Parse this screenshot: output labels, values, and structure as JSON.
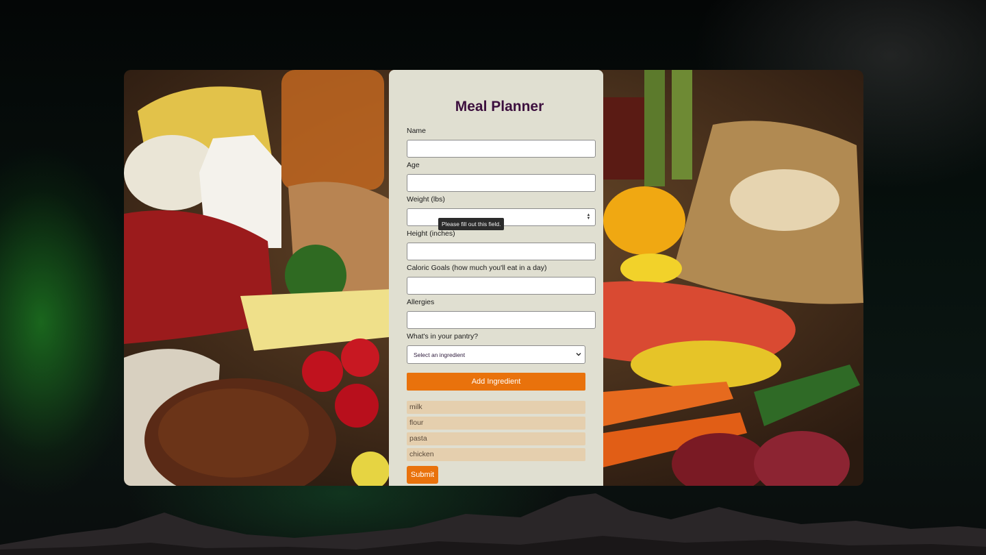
{
  "app": {
    "title": "Meal Planner"
  },
  "form": {
    "name": {
      "label": "Name",
      "value": ""
    },
    "age": {
      "label": "Age",
      "value": ""
    },
    "weight": {
      "label": "Weight (lbs)",
      "value": "",
      "validation_message": "Please fill out this field."
    },
    "height": {
      "label": "Height (inches)",
      "value": ""
    },
    "calories": {
      "label": "Caloric Goals (how much you'll eat in a day)",
      "value": ""
    },
    "allergies": {
      "label": "Allergies",
      "value": ""
    },
    "pantry": {
      "label": "What's in your pantry?",
      "select_placeholder": "Select an ingredient",
      "add_label": "Add Ingredient",
      "items": [
        "milk",
        "flour",
        "pasta",
        "chicken"
      ]
    },
    "submit_label": "Submit"
  },
  "colors": {
    "accent": "#e9720c",
    "title": "#3c0f3e",
    "panel": "#e0dfd1",
    "pantry_item": "#e5cfae"
  },
  "icons": {
    "select_chevron": "chevron-down-icon",
    "number_spinner": "spinner-icon"
  }
}
